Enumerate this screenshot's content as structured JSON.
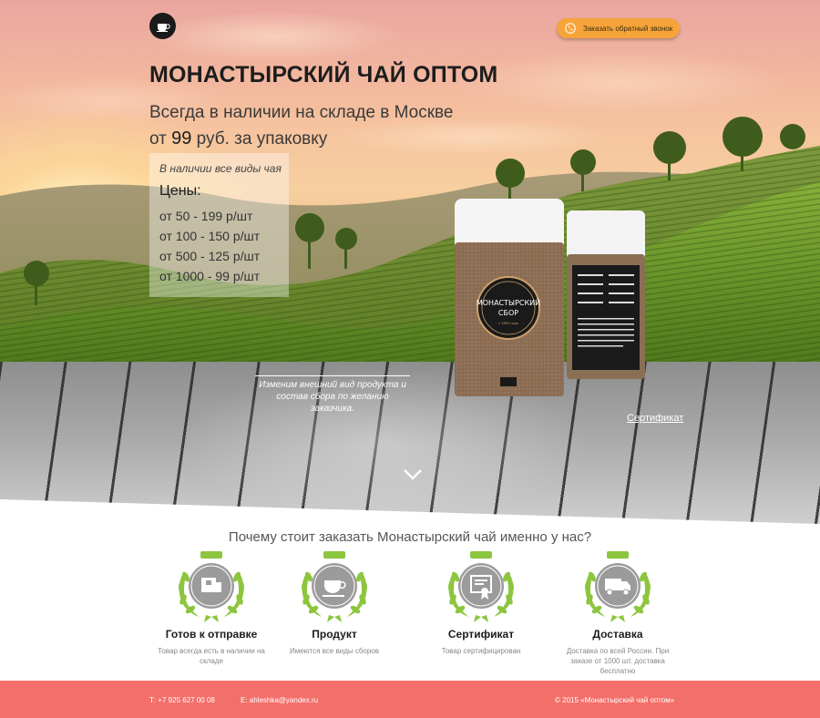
{
  "header": {
    "callback_label": "Заказать обратный звонок"
  },
  "hero": {
    "title": "МОНАСТЫРСКИЙ ЧАЙ ОПТОМ",
    "subtitle_line1": "Всегда в наличии на складе в Москве",
    "subtitle_prefix": "от",
    "subtitle_price": "99",
    "subtitle_suffix": "руб. за упаковку",
    "price_box": {
      "availability": "В наличии все виды чая",
      "prices_heading": "Цены:",
      "prices": [
        "от 50 - 199 р/шт",
        "от 100 - 150 р/шт",
        "от 500 - 125 р/шт",
        "от 1000 - 99 р/шт"
      ]
    },
    "package_note": "Изменим внешний вид продукта и состав сбора по желанию заказчика.",
    "certificate_link": "Сертификат",
    "package_label": {
      "line1": "МОНАСТЫРСКИЙ",
      "line2": "СБОР",
      "since": "с 1855 года"
    }
  },
  "benefits": {
    "title": "Почему стоит заказать Монастырский чай именно у нас?",
    "items": [
      {
        "title": "Готов к отправке",
        "desc": "Товар всегда есть в наличии на складе",
        "icon": "box-icon"
      },
      {
        "title": "Продукт",
        "desc": "Имеются все виды сборов",
        "icon": "tea-cup-icon"
      },
      {
        "title": "Сертификат",
        "desc": "Товар сертифицирован",
        "icon": "certificate-icon"
      },
      {
        "title": "Доставка",
        "desc": "Доставка по всей России. При заказе от 1000 шт. доставка бесплатно",
        "icon": "truck-icon"
      }
    ]
  },
  "footer": {
    "phone": "Т: +7 925 627 00 08",
    "email": "E: ahleshka@yandex.ru",
    "copyright": "© 2015 «Монастырский чай оптом»"
  },
  "colors": {
    "accent_orange": "#f6a43a",
    "footer_bg": "#f36f6a",
    "badge_green": "#8cc63f",
    "badge_gray": "#9b9b9b"
  }
}
